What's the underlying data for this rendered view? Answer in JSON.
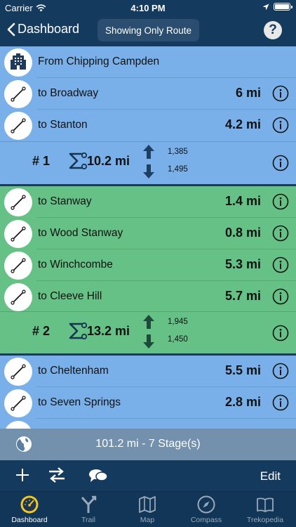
{
  "status_bar": {
    "carrier": "Carrier",
    "time": "4:10 PM"
  },
  "nav": {
    "back_label": "Dashboard",
    "toggle_label": "Showing Only Route",
    "help_label": "?"
  },
  "stages": [
    {
      "color": "#7ab0ea",
      "rows": [
        {
          "label": "From Chipping Campden",
          "distance": "",
          "icon": "hotel-icon"
        },
        {
          "label": "to Broadway",
          "distance": "6 mi",
          "icon": "route-segment-icon"
        },
        {
          "label": "to Stanton",
          "distance": "4.2 mi",
          "icon": "route-segment-icon"
        }
      ],
      "summary": {
        "number": "# 1",
        "total": "10.2 mi",
        "ascent": "1,385",
        "descent": "1,495"
      }
    },
    {
      "color": "#65c185",
      "rows": [
        {
          "label": "to Stanway",
          "distance": "1.4 mi",
          "icon": "route-segment-icon"
        },
        {
          "label": "to Wood Stanway",
          "distance": "0.8 mi",
          "icon": "route-segment-icon"
        },
        {
          "label": "to Winchcombe",
          "distance": "5.3 mi",
          "icon": "route-segment-icon"
        },
        {
          "label": "to Cleeve Hill",
          "distance": "5.7 mi",
          "icon": "route-segment-icon"
        }
      ],
      "summary": {
        "number": "# 2",
        "total": "13.2 mi",
        "ascent": "1,945",
        "descent": "1,450"
      }
    },
    {
      "color": "#7ab0ea",
      "rows": [
        {
          "label": "to Cheltenham",
          "distance": "5.5 mi",
          "icon": "route-segment-icon"
        },
        {
          "label": "to Seven Springs",
          "distance": "2.8 mi",
          "icon": "route-segment-icon"
        }
      ]
    }
  ],
  "footer": {
    "summary": "101.2 mi - 7 Stage(s)"
  },
  "toolbar": {
    "edit_label": "Edit"
  },
  "tabs": [
    {
      "label": "Dashboard",
      "icon": "speedometer-icon",
      "active": true
    },
    {
      "label": "Trail",
      "icon": "trail-fork-icon",
      "active": false
    },
    {
      "label": "Map",
      "icon": "map-icon",
      "active": false
    },
    {
      "label": "Compass",
      "icon": "compass-icon",
      "active": false
    },
    {
      "label": "Trekopedia",
      "icon": "book-icon",
      "active": false
    }
  ]
}
